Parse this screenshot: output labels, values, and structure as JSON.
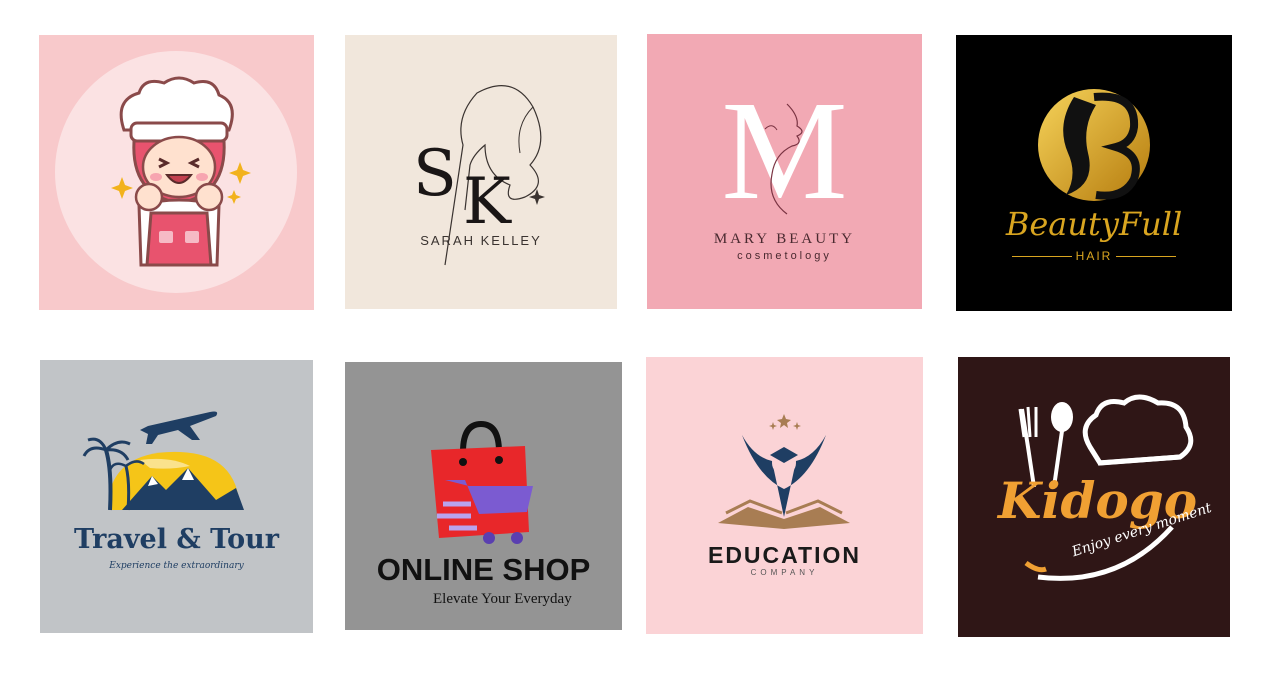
{
  "colors": {
    "chef_bg": "#f8c9cb",
    "sk_bg": "#f1e7dc",
    "mary_bg": "#f2a9b4",
    "beauty_bg": "#000000",
    "gold": "#d9a520",
    "travel_bg": "#c1c4c7",
    "navy": "#1f3e63",
    "shop_bg": "#949494",
    "shop_red": "#e8272a",
    "shop_purple": "#7b5bd1",
    "edu_bg": "#fbd3d6",
    "edu_brown": "#a87d53",
    "kidogo_bg": "#2f1616",
    "kidogo_orange": "#f0a033"
  },
  "logos": [
    {
      "id": "chef-girl",
      "icon": "chef-girl-mascot-icon"
    },
    {
      "id": "sarah-kelley",
      "monogram_s": "S",
      "monogram_k": "K",
      "name": "SARAH KELLEY"
    },
    {
      "id": "mary-beauty",
      "monogram": "M",
      "name": "MARY BEAUTY",
      "tagline": "cosmetology"
    },
    {
      "id": "beautyfull",
      "wordmark": "BeautyFull",
      "subtitle": "HAIR"
    },
    {
      "id": "travel-tour",
      "name": "Travel & Tour",
      "tagline": "Experience the extraordinary"
    },
    {
      "id": "online-shop",
      "name": "ONLINE SHOP",
      "tagline": "Elevate Your Everyday"
    },
    {
      "id": "education",
      "name": "EDUCATION",
      "subtitle": "COMPANY"
    },
    {
      "id": "kidogo",
      "name": "Kidogo",
      "tagline": "Enjoy every moment"
    }
  ]
}
